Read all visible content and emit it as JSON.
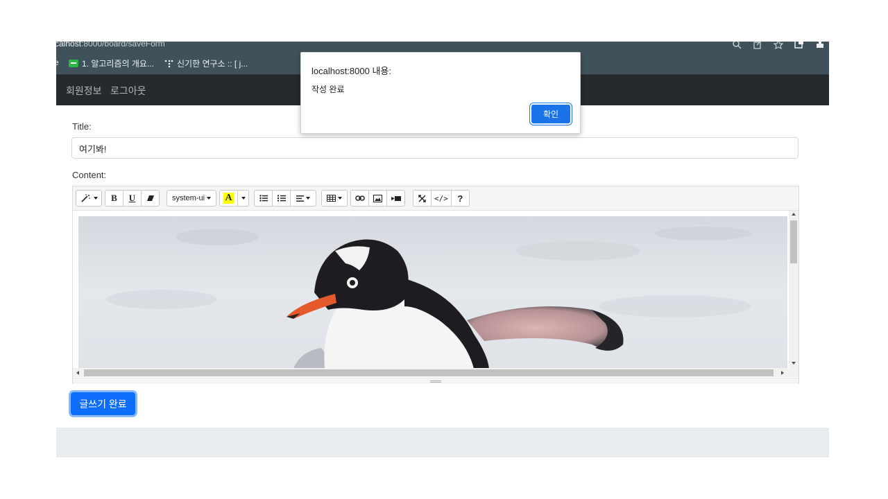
{
  "browser": {
    "url_host": "calhost",
    "url_rest": ":8000/board/saveForm",
    "bookmark_partial": "e",
    "bookmarks": [
      {
        "label": "1. 알고리즘의 개요...",
        "icon": "green-chat-favicon"
      },
      {
        "label": "신기한 연구소 :: [ j...",
        "icon": "dots-favicon"
      }
    ]
  },
  "navbar": {
    "links": [
      "회원정보",
      "로그아웃"
    ]
  },
  "form": {
    "title_label": "Title:",
    "title_value": "여기봐!",
    "content_label": "Content:",
    "font_name": "system-ui",
    "submit_label": "글쓰기 완료"
  },
  "toolbar_icons": [
    "magic-style-icon",
    "bold-icon",
    "underline-icon",
    "eraser-icon",
    "font-name-dropdown",
    "text-color-icon",
    "unordered-list-icon",
    "ordered-list-icon",
    "paragraph-align-icon",
    "table-icon",
    "link-icon",
    "picture-icon",
    "video-icon",
    "fullscreen-icon",
    "code-view-icon",
    "help-icon"
  ],
  "editor_content": {
    "image": "gentoo-penguin-on-snow"
  },
  "dialog": {
    "title": "localhost:8000 내용:",
    "message": "작성 완료",
    "ok_label": "확인"
  }
}
